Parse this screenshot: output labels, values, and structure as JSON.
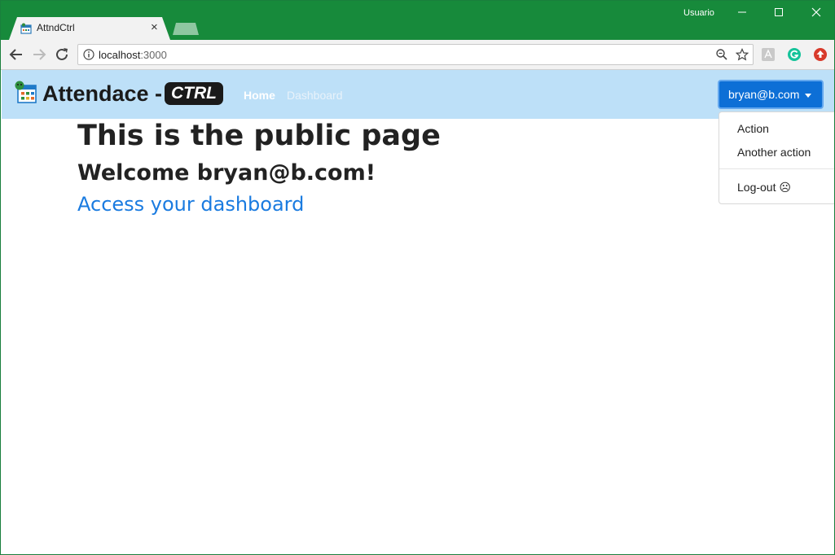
{
  "browser": {
    "tab_title": "AttndCtrl",
    "tab_close": "×",
    "user": "Usuario",
    "url_host": "localhost",
    "url_port": ":3000"
  },
  "navbar": {
    "brand_text": "Attendace -",
    "brand_badge": "CTRL",
    "links": [
      {
        "label": "Home"
      },
      {
        "label": "Dashboard"
      }
    ],
    "user_button": "bryan@b.com"
  },
  "dropdown": {
    "items": [
      {
        "label": "Action"
      },
      {
        "label": "Another action"
      },
      {
        "label": "Log-out ☹"
      }
    ]
  },
  "main": {
    "title": "This is the public page",
    "welcome": "Welcome bryan@b.com!",
    "dashboard_link": "Access your dashboard"
  },
  "colors": {
    "titlebar": "#178a3b",
    "navbar": "#bde0f8",
    "primary": "#0d6fd6",
    "link": "#1a7be0"
  }
}
